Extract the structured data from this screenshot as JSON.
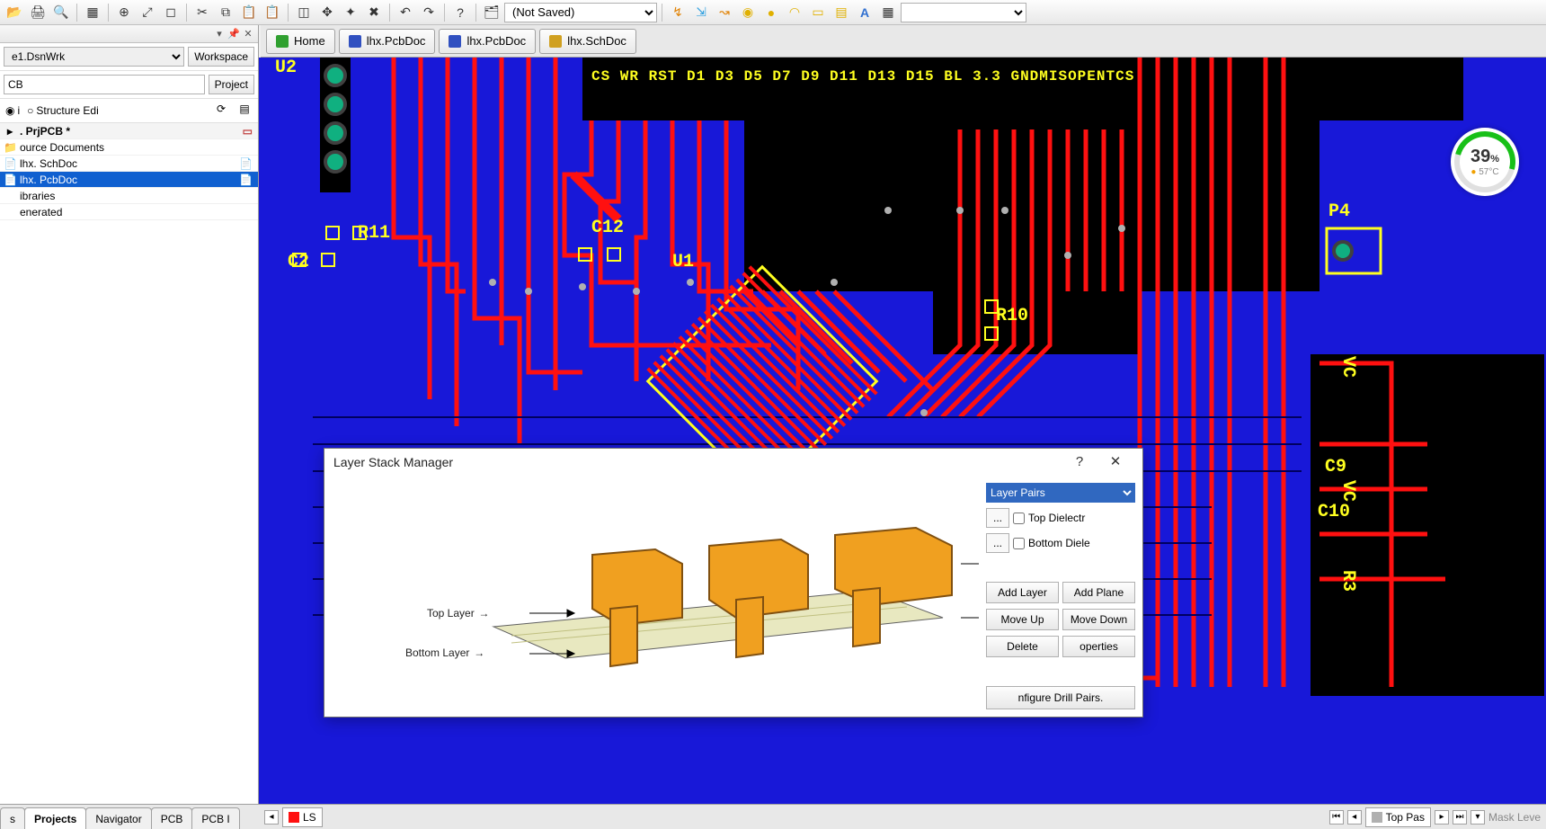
{
  "toolbar": {
    "saved_combo": "(Not Saved)"
  },
  "panel": {
    "workspace_value": "e1.DsnWrk",
    "workspace_btn": "Workspace",
    "project_value": "CB",
    "project_btn": "Project",
    "mode_file": "i",
    "mode_structure": "Structure Edi"
  },
  "tree": {
    "header": ". PrjPCB *",
    "items": [
      {
        "label": "ource Documents",
        "icon": "📁"
      },
      {
        "label": "lhx. SchDoc",
        "icon": "📄",
        "end": "📄"
      },
      {
        "label": "lhx. PcbDoc",
        "icon": "📄",
        "end": "📄",
        "selected": true
      },
      {
        "label": "ibraries",
        "icon": ""
      },
      {
        "label": "enerated",
        "icon": ""
      }
    ]
  },
  "left_tabs": [
    "s",
    "Projects",
    "Navigator",
    "PCB",
    "PCB I"
  ],
  "left_tabs_active": 1,
  "doc_tabs": [
    {
      "label": "Home",
      "color": "#30a030"
    },
    {
      "label": "lhx.PcbDoc",
      "color": "#3050c0"
    },
    {
      "label": "lhx.PcbDoc",
      "color": "#3050c0"
    },
    {
      "label": "lhx.SchDoc",
      "color": "#d0a020"
    }
  ],
  "silk": {
    "header": "CS  WR  RST  D1   D3   D5  D7   D9   D11  D13 D15   BL  3.3  GNDMISOPENTCS",
    "u2": "U2",
    "r11": "R11",
    "c2": "C2",
    "c12": "C12",
    "u1": "U1",
    "r10": "R10",
    "p4": "P4",
    "vc": "VC",
    "c9": "C9",
    "vc2": "VC",
    "c10": "C10",
    "r3": "R3"
  },
  "gauge": {
    "percent": "39",
    "pct_sym": "%",
    "temp": "57°C"
  },
  "dialog": {
    "title": "Layer Stack Manager",
    "pairs": "Layer Pairs",
    "top_dielectric": "Top Dielectr",
    "bottom_dielectric": "Bottom Diele",
    "add_layer": "Add Layer",
    "add_plane": "Add Plane",
    "move_up": "Move Up",
    "move_down": "Move Down",
    "delete": "Delete",
    "properties": "operties",
    "drill": "nfigure Drill Pairs.",
    "top_layer": "Top Layer",
    "bottom_layer": "Bottom Layer"
  },
  "bottom": {
    "ls": "LS",
    "top_paste": "Top Pas",
    "mask": "Mask Leve"
  }
}
